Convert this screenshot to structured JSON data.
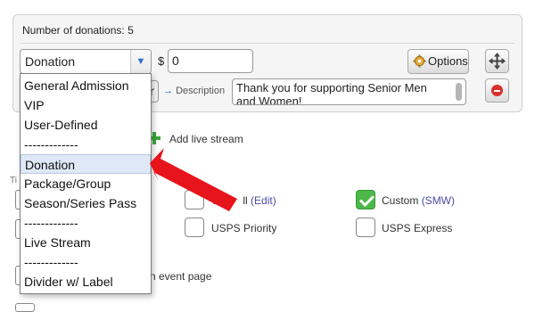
{
  "panel": {
    "title": "Number of donations: 5",
    "ticket_type_value": "Donation",
    "currency_symbol": "$",
    "amount_value": "0",
    "options_label": "Options",
    "description_label": "Description",
    "description_value": "Thank you for supporting Senior Men and Women!"
  },
  "dropdown": {
    "options": [
      "General Admission",
      "VIP",
      "User-Defined",
      "-------------",
      "Donation",
      "Package/Group",
      "Season/Series Pass",
      "-------------",
      "Live Stream",
      "-------------",
      "Divider w/ Label"
    ],
    "selected": "Donation"
  },
  "add_live_stream_label": "Add live stream",
  "ti_fragment": "Ti",
  "shipping": {
    "will_call_prefix": "W",
    "will_call_suffix": "ll",
    "will_call_edit": "(Edit)",
    "custom_label": "Custom",
    "custom_link": "(SMW)",
    "usps_priority": "USPS Priority",
    "usps_express": "USPS Express"
  },
  "event_page_label": "n event page",
  "colors": {
    "accent_blue": "#2b6fd6",
    "check_green": "#4cb848",
    "delete_red": "#d9302a",
    "annotation_arrow": "#e8141b"
  }
}
